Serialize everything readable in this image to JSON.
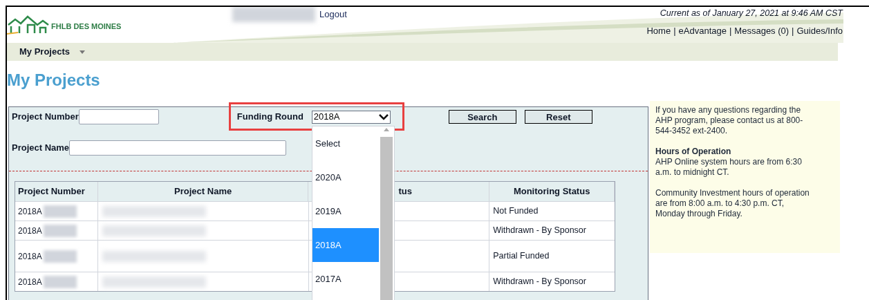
{
  "header": {
    "logo_text": "FHLB DES MOINES",
    "logout": "Logout",
    "as_of": "Current as of January 27, 2021 at 9:46 AM CST",
    "links": [
      "Home",
      "eAdvantage",
      "Messages (0)",
      "Guides/Info"
    ],
    "separator": "|"
  },
  "nav": [
    {
      "label": "My Projects"
    }
  ],
  "page_title": "My Projects",
  "search": {
    "project_number_label": "Project Number",
    "project_name_label": "Project Name",
    "funding_round_label": "Funding Round",
    "funding_round_value": "2018A",
    "buttons": [
      "Search",
      "Reset"
    ]
  },
  "dropdown": {
    "options": [
      {
        "label": "Select",
        "selected": false
      },
      {
        "label": "2020A",
        "selected": false
      },
      {
        "label": "2019A",
        "selected": false
      },
      {
        "label": "2018A",
        "selected": true
      },
      {
        "label": "2017A",
        "selected": false
      }
    ]
  },
  "table": {
    "columns": [
      "Project Number",
      "Project Name",
      "tus",
      "Monitoring Status"
    ],
    "rows": [
      {
        "project_number": "2018A",
        "monitoring_status": "Not Funded",
        "tall": false
      },
      {
        "project_number": "2018A",
        "monitoring_status": "Withdrawn - By Sponsor",
        "tall": false
      },
      {
        "project_number": "2018A",
        "monitoring_status": "Partial Funded",
        "tall": true
      },
      {
        "project_number": "2018A",
        "monitoring_status": "Withdrawn - By Sponsor",
        "tall": false
      }
    ]
  },
  "info": {
    "contact": "If you have any questions regarding the AHP program, please contact us at 800-544-3452 ext-2400.",
    "hours_heading": "Hours of Operation",
    "hours_online": "AHP Online system hours are from 6:30 a.m. to midnight CT.",
    "hours_ci": "Community Investment hours of operation are from 8:00 a.m. to 4:30 p.m. CT, Monday through Friday."
  }
}
